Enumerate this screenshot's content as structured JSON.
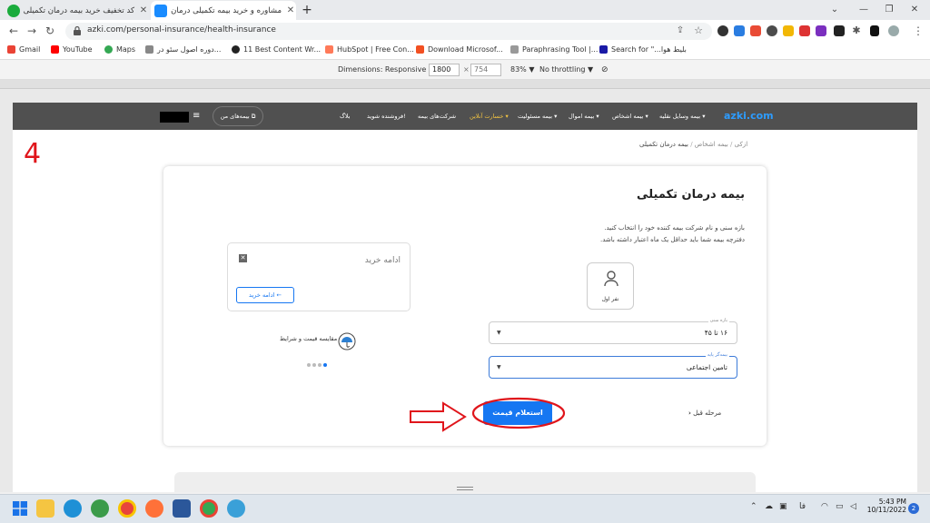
{
  "browser": {
    "tabs": [
      {
        "title": "کد تخفیف خرید بیمه درمان تکمیلی",
        "favicon_color": "#1aab3c"
      },
      {
        "title": "مشاوره و خرید بیمه تکمیلی درمان - ...",
        "favicon_color": "#1a8cff",
        "active": true
      }
    ],
    "url": "azki.com/personal-insurance/health-insurance",
    "bookmarks": [
      "Gmail",
      "YouTube",
      "Maps",
      "دوره اصول سئو در...",
      "11 Best Content Wr...",
      "HubSpot | Free Con...",
      "Download Microsof...",
      "Paraphrasing Tool |...",
      "Search for \"...بلیط هوا"
    ]
  },
  "devtools": {
    "dimensions_label": "Dimensions: Responsive ▼",
    "width": "1800",
    "height": "754",
    "zoom": "83% ▼",
    "throttle": "No throttling ▼"
  },
  "site": {
    "logo": "azki.com",
    "nav": [
      "بیمه وسایل نقلیه",
      "بیمه اشخاص",
      "بیمه اموال",
      "بیمه مسئولیت",
      "خسارت آنلاین",
      "شرکت‌های بیمه",
      "فروشنده شوید!",
      "بلاگ"
    ],
    "my_policies": "بیمه‌های من",
    "breadcrumb": [
      "ازکی",
      "بیمه اشخاص",
      "بیمه درمان تکمیلی"
    ],
    "heading": "بیمه درمان تکمیلی",
    "desc_line1": "بازه سنی و نام شرکت بیمه کننده خود را انتخاب کنید.",
    "desc_line2": "دفترچه بیمه شما باید حداقل یک ماه اعتبار داشته باشد.",
    "person_label": "نفر اول",
    "age_label": "بازه سنی",
    "age_value": "۱۶ تا ۴۵",
    "insurer_label": "بیمه‌گر پایه",
    "insurer_value": "تامین اجتماعی",
    "inquiry_button": "استعلام قیمت",
    "back_link": "مرحله قبل",
    "continue_panel_title": "ادامه خرید",
    "continue_button": "ادامه خرید",
    "compare_text": "مقایسه قیمت و شرایط",
    "step_number": "4"
  },
  "taskbar": {
    "time": "5:43 PM",
    "date": "10/11/2022",
    "lang": "فا",
    "notifications": "2"
  }
}
